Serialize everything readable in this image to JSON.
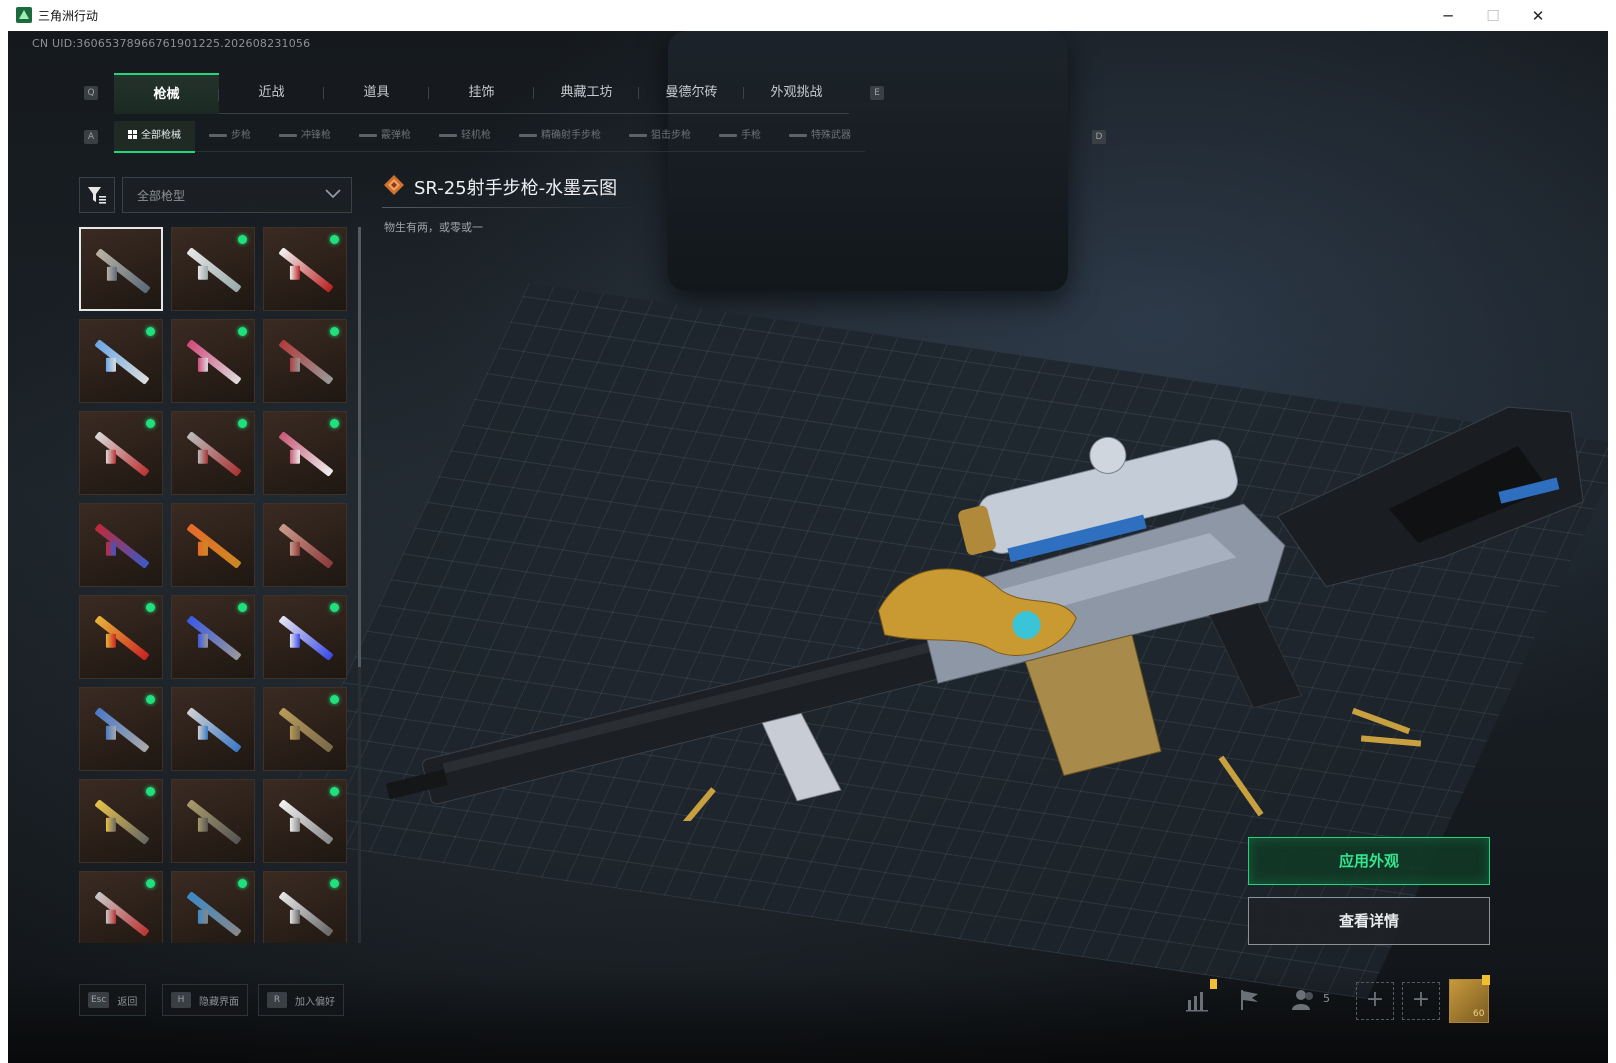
{
  "window": {
    "title": "三角洲行动",
    "controls": {
      "minimize": "─",
      "maximize": "☐",
      "close": "✕"
    }
  },
  "uid": "CN UID:3606537896676190122​5.202608231056",
  "main_tabs": {
    "prev_key": "Q",
    "next_key": "E",
    "items": [
      {
        "label": "枪械",
        "active": true
      },
      {
        "label": "近战",
        "active": false
      },
      {
        "label": "道具",
        "active": false
      },
      {
        "label": "挂饰",
        "active": false
      },
      {
        "label": "典藏工坊",
        "active": false
      },
      {
        "label": "曼德尔砖",
        "active": false
      },
      {
        "label": "外观挑战",
        "active": false
      }
    ]
  },
  "sub_tabs": {
    "prev_key": "A",
    "next_key": "D",
    "items": [
      {
        "label": "全部枪械",
        "active": true
      },
      {
        "label": "步枪",
        "active": false
      },
      {
        "label": "冲锋枪",
        "active": false
      },
      {
        "label": "霰弹枪",
        "active": false
      },
      {
        "label": "轻机枪",
        "active": false
      },
      {
        "label": "精确射手步枪",
        "active": false
      },
      {
        "label": "狙击步枪",
        "active": false
      },
      {
        "label": "手枪",
        "active": false
      },
      {
        "label": "特殊武器",
        "active": false
      }
    ]
  },
  "filter": {
    "dropdown_value": "全部枪型"
  },
  "skins": [
    {
      "colors": [
        "#b9b2a2",
        "#5a6a7a"
      ],
      "dot": false,
      "selected": true
    },
    {
      "colors": [
        "#e6e6e6",
        "#9aa"
      ],
      "dot": true,
      "selected": false
    },
    {
      "colors": [
        "#f2f2f2",
        "#b22"
      ],
      "dot": true,
      "selected": false
    },
    {
      "colors": [
        "#6aa8e6",
        "#ddd"
      ],
      "dot": true,
      "selected": false
    },
    {
      "colors": [
        "#d24a7a",
        "#ddd"
      ],
      "dot": true,
      "selected": false
    },
    {
      "colors": [
        "#b23b3b",
        "#999"
      ],
      "dot": true,
      "selected": false
    },
    {
      "colors": [
        "#d9d9d9",
        "#b33"
      ],
      "dot": true,
      "selected": false
    },
    {
      "colors": [
        "#bbb",
        "#a33"
      ],
      "dot": true,
      "selected": false
    },
    {
      "colors": [
        "#c85a78",
        "#eee"
      ],
      "dot": true,
      "selected": false
    },
    {
      "colors": [
        "#c0283a",
        "#3a5ac8"
      ],
      "dot": false,
      "selected": false
    },
    {
      "colors": [
        "#e66a2a",
        "#c82"
      ],
      "dot": false,
      "selected": false
    },
    {
      "colors": [
        "#c99a8a",
        "#8a3a3a"
      ],
      "dot": false,
      "selected": false
    },
    {
      "colors": [
        "#e6b43a",
        "#c22"
      ],
      "dot": true,
      "selected": false
    },
    {
      "colors": [
        "#3a5ae6",
        "#999"
      ],
      "dot": true,
      "selected": false
    },
    {
      "colors": [
        "#e6e6f2",
        "#3a4ae6"
      ],
      "dot": true,
      "selected": false
    },
    {
      "colors": [
        "#4a7ac8",
        "#aaa"
      ],
      "dot": true,
      "selected": false
    },
    {
      "colors": [
        "#d0d0d0",
        "#3a7ac8"
      ],
      "dot": false,
      "selected": false
    },
    {
      "colors": [
        "#b89a5a",
        "#7a6a4a"
      ],
      "dot": true,
      "selected": false
    },
    {
      "colors": [
        "#e6c24a",
        "#666"
      ],
      "dot": true,
      "selected": false
    },
    {
      "colors": [
        "#a89a6a",
        "#555"
      ],
      "dot": false,
      "selected": false
    },
    {
      "colors": [
        "#f0f0f0",
        "#888"
      ],
      "dot": true,
      "selected": false
    },
    {
      "colors": [
        "#c8c8c8",
        "#b33"
      ],
      "dot": true,
      "selected": false
    },
    {
      "colors": [
        "#3a8ac8",
        "#888"
      ],
      "dot": true,
      "selected": false
    },
    {
      "colors": [
        "#e6e6e6",
        "#666"
      ],
      "dot": true,
      "selected": false
    }
  ],
  "item": {
    "title": "SR-25射手步枪-水墨云图",
    "description": "物生有两，或零或一"
  },
  "buttons": {
    "apply": "应用外观",
    "details": "查看详情"
  },
  "hints": [
    {
      "key": "Esc",
      "label": "返回"
    },
    {
      "key": "H",
      "label": "隐藏界面"
    },
    {
      "key": "R",
      "label": "加入偏好"
    }
  ],
  "footer": {
    "friends_count": "5",
    "avatar_level": "60"
  },
  "colors": {
    "accent": "#1fd67a",
    "background": "#0c0e10"
  }
}
